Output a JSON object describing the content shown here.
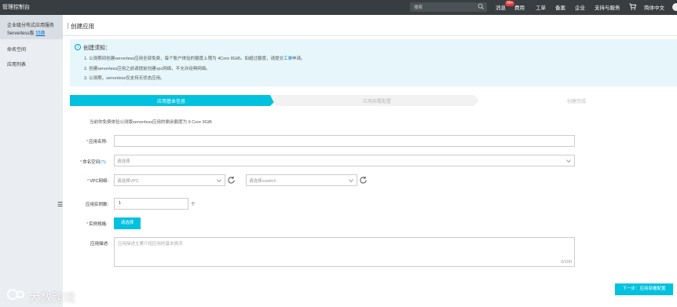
{
  "topbar": {
    "brand": "管理控制台",
    "search_placeholder": "搜索",
    "nav": [
      "消息",
      "费用",
      "工单",
      "备案",
      "企业",
      "支持与服务",
      "简体中文"
    ],
    "badge": "99+"
  },
  "sidebar": {
    "title": "企业级分布式应用服务",
    "subtitle": "Serverless版",
    "switch_link": "切换",
    "items": [
      "命名空间",
      "应用列表"
    ]
  },
  "page": {
    "title": "创建应用"
  },
  "notice": {
    "heading": "创建须知：",
    "lines": [
      "1. 公测期间创建serverless应用全部免费，每个账户体验的额度上限为 4Core 8GiB。如超过额度，请提交",
      "2. 创建serverless应用之前请提前创建vpc网络，不允许经典网络。",
      "3. 公测期，serverless仅支持无状态应用。"
    ],
    "line1_link": "工单",
    "line1_suffix": "申请。"
  },
  "steps": [
    "应用基本信息",
    "应用部署配置",
    "创建完成"
  ],
  "form": {
    "quota_text": "当前你免费体验公测版serverless应用的剩余额度为 9 Core 9GiB",
    "app_name_label": "应用名称:",
    "namespace_label": "命名空间",
    "namespace_help": "?",
    "namespace_placeholder": "请选择",
    "vpc_label": "VPC网络:",
    "vpc_placeholder": "请选择VPC",
    "vswitch_placeholder": "请选择vswitch",
    "instances_label": "应用实例数:",
    "instances_value": "1",
    "instances_unit": "个",
    "spec_label": "实例规格:",
    "spec_button": "请选择",
    "desc_label": "应用描述:",
    "desc_placeholder": "应用描述主要介绍应用的基本情况",
    "desc_count": "0/100",
    "next_button": "下一步：应用部署配置"
  },
  "watermark": "大数跨境",
  "colors": {
    "accent": "#00c1de",
    "topbar": "#373d41",
    "sidebar": "#eaedf1",
    "notice_bg": "#e6f6fa",
    "required": "#e4393c"
  }
}
